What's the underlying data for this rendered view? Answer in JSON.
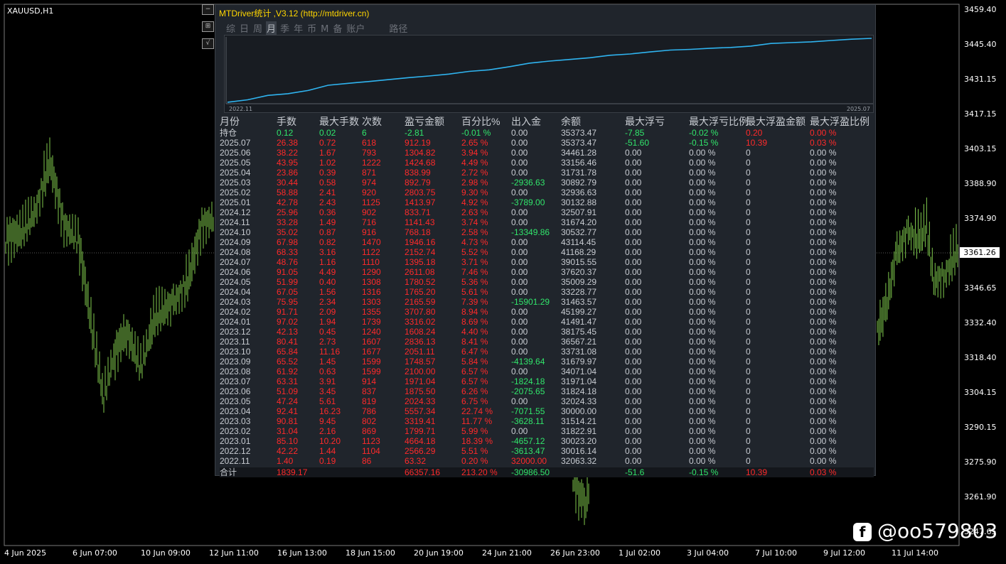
{
  "chart": {
    "symbol": "XAUUSD,H1",
    "price_ticks": [
      "3459.40",
      "3445.40",
      "3431.15",
      "3417.15",
      "3403.15",
      "3388.90",
      "3374.90",
      "3346.65",
      "3332.40",
      "3318.40",
      "3304.15",
      "3290.15",
      "3275.90",
      "3261.90",
      "3247.65"
    ],
    "current_price": "3361.26",
    "time_ticks": [
      "4 Jun 2025",
      "6 Jun 07:00",
      "10 Jun 09:00",
      "12 Jun 11:00",
      "16 Jun 13:00",
      "18 Jun 15:00",
      "20 Jun 19:00",
      "24 Jun 21:00",
      "26 Jun 23:00",
      "1 Jul 02:00",
      "3 Jul 04:00",
      "7 Jul 10:00",
      "9 Jul 12:00",
      "11 Jul 14:00"
    ],
    "candle_color": "#7fc94d",
    "side_buttons": [
      "−",
      "⊞",
      "√"
    ]
  },
  "panel": {
    "title": "MTDriver统计 ,V3.12 (http://mtdriver.cn)",
    "tabs": [
      "综",
      "日",
      "周",
      "月",
      "季",
      "年",
      "币",
      "M",
      "备",
      "账户",
      "路径"
    ],
    "active_tab": "月",
    "curve": {
      "start_label": "2022.11",
      "end_label": "2025.07",
      "line_color": "#2fb4f0"
    },
    "headers": [
      "月份",
      "手数",
      "最大手数",
      "次数",
      "盈亏金额",
      "百分比%",
      "出入金",
      "余额",
      "最大浮亏",
      "最大浮亏比例",
      "最大浮盈金额",
      "最大浮盈比例"
    ],
    "position_row": [
      "持仓",
      "0.12",
      "0.02",
      "6",
      "-2.81",
      "-0.01 %",
      "0.00",
      "35373.47",
      "-7.85",
      "-0.02 %",
      "0.20",
      "0.00 %"
    ],
    "rows": [
      [
        "2025.07",
        "26.38",
        "0.72",
        "618",
        "912.19",
        "2.65 %",
        "0.00",
        "35373.47",
        "-51.60",
        "-0.15 %",
        "10.39",
        "0.03 %"
      ],
      [
        "2025.06",
        "38.22",
        "1.67",
        "793",
        "1304.82",
        "3.94 %",
        "0.00",
        "34461.28",
        "0.00",
        "0.00 %",
        "0",
        "0.00 %"
      ],
      [
        "2025.05",
        "43.95",
        "1.02",
        "1222",
        "1424.68",
        "4.49 %",
        "0.00",
        "33156.46",
        "0.00",
        "0.00 %",
        "0",
        "0.00 %"
      ],
      [
        "2025.04",
        "23.86",
        "0.39",
        "871",
        "838.99",
        "2.72 %",
        "0.00",
        "31731.78",
        "0.00",
        "0.00 %",
        "0",
        "0.00 %"
      ],
      [
        "2025.03",
        "30.44",
        "0.58",
        "974",
        "892.79",
        "2.98 %",
        "-2936.63",
        "30892.79",
        "0.00",
        "0.00 %",
        "0",
        "0.00 %"
      ],
      [
        "2025.02",
        "58.88",
        "2.41",
        "920",
        "2803.75",
        "9.30 %",
        "0.00",
        "32936.63",
        "0.00",
        "0.00 %",
        "0",
        "0.00 %"
      ],
      [
        "2025.01",
        "42.78",
        "2.43",
        "1125",
        "1413.97",
        "4.92 %",
        "-3789.00",
        "30132.88",
        "0.00",
        "0.00 %",
        "0",
        "0.00 %"
      ],
      [
        "2024.12",
        "25.96",
        "0.36",
        "902",
        "833.71",
        "2.63 %",
        "0.00",
        "32507.91",
        "0.00",
        "0.00 %",
        "0",
        "0.00 %"
      ],
      [
        "2024.11",
        "33.28",
        "1.49",
        "716",
        "1141.43",
        "3.74 %",
        "0.00",
        "31674.20",
        "0.00",
        "0.00 %",
        "0",
        "0.00 %"
      ],
      [
        "2024.10",
        "35.02",
        "0.87",
        "916",
        "768.18",
        "2.58 %",
        "-13349.86",
        "30532.77",
        "0.00",
        "0.00 %",
        "0",
        "0.00 %"
      ],
      [
        "2024.09",
        "67.98",
        "0.82",
        "1470",
        "1946.16",
        "4.73 %",
        "0.00",
        "43114.45",
        "0.00",
        "0.00 %",
        "0",
        "0.00 %"
      ],
      [
        "2024.08",
        "68.33",
        "3.16",
        "1122",
        "2152.74",
        "5.52 %",
        "0.00",
        "41168.29",
        "0.00",
        "0.00 %",
        "0",
        "0.00 %"
      ],
      [
        "2024.07",
        "48.76",
        "1.16",
        "1110",
        "1395.18",
        "3.71 %",
        "0.00",
        "39015.55",
        "0.00",
        "0.00 %",
        "0",
        "0.00 %"
      ],
      [
        "2024.06",
        "91.05",
        "4.49",
        "1290",
        "2611.08",
        "7.46 %",
        "0.00",
        "37620.37",
        "0.00",
        "0.00 %",
        "0",
        "0.00 %"
      ],
      [
        "2024.05",
        "51.99",
        "0.40",
        "1308",
        "1780.52",
        "5.36 %",
        "0.00",
        "35009.29",
        "0.00",
        "0.00 %",
        "0",
        "0.00 %"
      ],
      [
        "2024.04",
        "67.05",
        "1.56",
        "1316",
        "1765.20",
        "5.61 %",
        "0.00",
        "33228.77",
        "0.00",
        "0.00 %",
        "0",
        "0.00 %"
      ],
      [
        "2024.03",
        "75.95",
        "2.34",
        "1303",
        "2165.59",
        "7.39 %",
        "-15901.29",
        "31463.57",
        "0.00",
        "0.00 %",
        "0",
        "0.00 %"
      ],
      [
        "2024.02",
        "91.71",
        "2.09",
        "1355",
        "3707.80",
        "8.94 %",
        "0.00",
        "45199.27",
        "0.00",
        "0.00 %",
        "0",
        "0.00 %"
      ],
      [
        "2024.01",
        "97.02",
        "1.94",
        "1739",
        "3316.02",
        "8.69 %",
        "0.00",
        "41491.47",
        "0.00",
        "0.00 %",
        "0",
        "0.00 %"
      ],
      [
        "2023.12",
        "42.13",
        "0.45",
        "1240",
        "1608.24",
        "4.40 %",
        "0.00",
        "38175.45",
        "0.00",
        "0.00 %",
        "0",
        "0.00 %"
      ],
      [
        "2023.11",
        "80.41",
        "2.73",
        "1607",
        "2836.13",
        "8.41 %",
        "0.00",
        "36567.21",
        "0.00",
        "0.00 %",
        "0",
        "0.00 %"
      ],
      [
        "2023.10",
        "65.84",
        "11.16",
        "1677",
        "2051.11",
        "6.47 %",
        "0.00",
        "33731.08",
        "0.00",
        "0.00 %",
        "0",
        "0.00 %"
      ],
      [
        "2023.09",
        "65.52",
        "1.45",
        "1599",
        "1748.57",
        "5.84 %",
        "-4139.64",
        "31679.97",
        "0.00",
        "0.00 %",
        "0",
        "0.00 %"
      ],
      [
        "2023.08",
        "61.92",
        "0.63",
        "1599",
        "2100.00",
        "6.57 %",
        "0.00",
        "34071.04",
        "0.00",
        "0.00 %",
        "0",
        "0.00 %"
      ],
      [
        "2023.07",
        "63.31",
        "3.91",
        "914",
        "1971.04",
        "6.57 %",
        "-1824.18",
        "31971.04",
        "0.00",
        "0.00 %",
        "0",
        "0.00 %"
      ],
      [
        "2023.06",
        "51.09",
        "3.45",
        "837",
        "1875.50",
        "6.26 %",
        "-2075.65",
        "31824.18",
        "0.00",
        "0.00 %",
        "0",
        "0.00 %"
      ],
      [
        "2023.05",
        "47.24",
        "5.61",
        "819",
        "2024.33",
        "6.75 %",
        "0.00",
        "32024.33",
        "0.00",
        "0.00 %",
        "0",
        "0.00 %"
      ],
      [
        "2023.04",
        "92.41",
        "16.23",
        "786",
        "5557.34",
        "22.74 %",
        "-7071.55",
        "30000.00",
        "0.00",
        "0.00 %",
        "0",
        "0.00 %"
      ],
      [
        "2023.03",
        "90.81",
        "9.45",
        "802",
        "3319.41",
        "11.77 %",
        "-3628.11",
        "31514.21",
        "0.00",
        "0.00 %",
        "0",
        "0.00 %"
      ],
      [
        "2023.02",
        "31.04",
        "2.16",
        "869",
        "1799.71",
        "5.99 %",
        "0.00",
        "31822.91",
        "0.00",
        "0.00 %",
        "0",
        "0.00 %"
      ],
      [
        "2023.01",
        "85.10",
        "10.20",
        "1123",
        "4664.18",
        "18.39 %",
        "-4657.12",
        "30023.20",
        "0.00",
        "0.00 %",
        "0",
        "0.00 %"
      ],
      [
        "2022.12",
        "42.22",
        "1.44",
        "1104",
        "2566.29",
        "5.51 %",
        "-3613.47",
        "30016.14",
        "0.00",
        "0.00 %",
        "0",
        "0.00 %"
      ],
      [
        "2022.11",
        "1.40",
        "0.19",
        "86",
        "63.32",
        "0.20 %",
        "32000.00",
        "32063.32",
        "0.00",
        "0.00 %",
        "0",
        "0.00 %"
      ]
    ],
    "total_row": [
      "合计",
      "1839.17",
      "",
      "",
      "66357.16",
      "213.20 %",
      "-30986.50",
      "",
      "-51.6",
      "-0.15 %",
      "10.39",
      "0.03 %"
    ]
  },
  "watermark": {
    "icon": "f",
    "text": "@oo579803"
  }
}
